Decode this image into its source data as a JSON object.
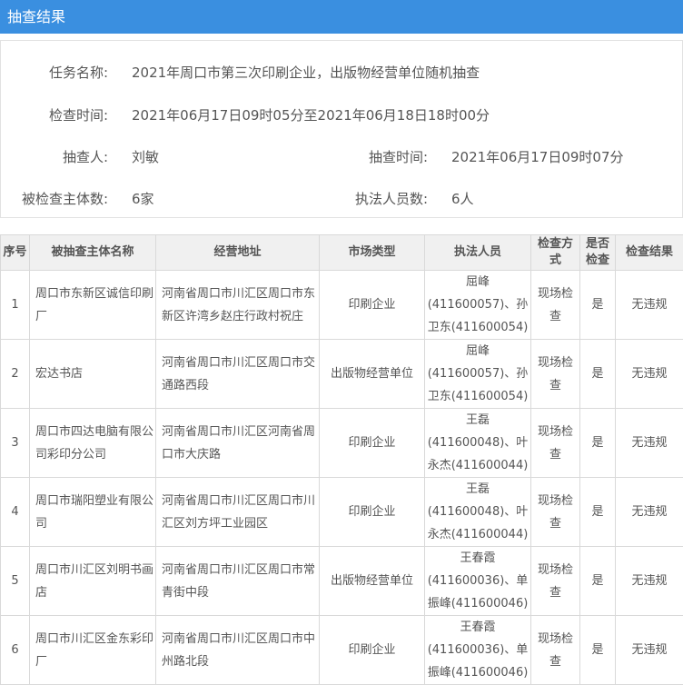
{
  "header": {
    "title": "抽查结果"
  },
  "info": {
    "task_name_label": "任务名称:",
    "task_name": "2021年周口市第三次印刷企业，出版物经营单位随机抽查",
    "check_time_label": "检查时间:",
    "check_time": "2021年06月17日09时05分至2021年06月18日18时00分",
    "inspector_label": "抽查人:",
    "inspector": "刘敏",
    "spot_time_label": "抽查时间:",
    "spot_time": "2021年06月17日09时07分",
    "subject_count_label": "被检查主体数:",
    "subject_count": "6家",
    "officer_count_label": "执法人员数:",
    "officer_count": "6人"
  },
  "table": {
    "headers": [
      "序号",
      "被抽查主体名称",
      "经营地址",
      "市场类型",
      "执法人员",
      "检查方式",
      "是否检查",
      "检查结果"
    ],
    "rows": [
      [
        "1",
        "周口市东新区诚信印刷厂",
        "河南省周口市川汇区周口市东新区许湾乡赵庄行政村祝庄",
        "印刷企业",
        "屈峰(411600057)、孙卫东(411600054)",
        "现场检查",
        "是",
        "无违规"
      ],
      [
        "2",
        "宏达书店",
        "河南省周口市川汇区周口市交通路西段",
        "出版物经营单位",
        "屈峰(411600057)、孙卫东(411600054)",
        "现场检查",
        "是",
        "无违规"
      ],
      [
        "3",
        "周口市四达电脑有限公司彩印分公司",
        "河南省周口市川汇区河南省周口市大庆路",
        "印刷企业",
        "王磊(411600048)、叶永杰(411600044)",
        "现场检查",
        "是",
        "无违规"
      ],
      [
        "4",
        "周口市瑞阳塑业有限公司",
        "河南省周口市川汇区周口市川汇区刘方坪工业园区",
        "印刷企业",
        "王磊(411600048)、叶永杰(411600044)",
        "现场检查",
        "是",
        "无违规"
      ],
      [
        "5",
        "周口市川汇区刘明书画店",
        "河南省周口市川汇区周口市常青街中段",
        "出版物经营单位",
        "王春霞(411600036)、单振峰(411600046)",
        "现场检查",
        "是",
        "无违规"
      ],
      [
        "6",
        "周口市川汇区金东彩印厂",
        "河南省周口市川汇区周口市中州路北段",
        "印刷企业",
        "王春霞(411600036)、单振峰(411600046)",
        "现场检查",
        "是",
        "无违规"
      ]
    ]
  }
}
